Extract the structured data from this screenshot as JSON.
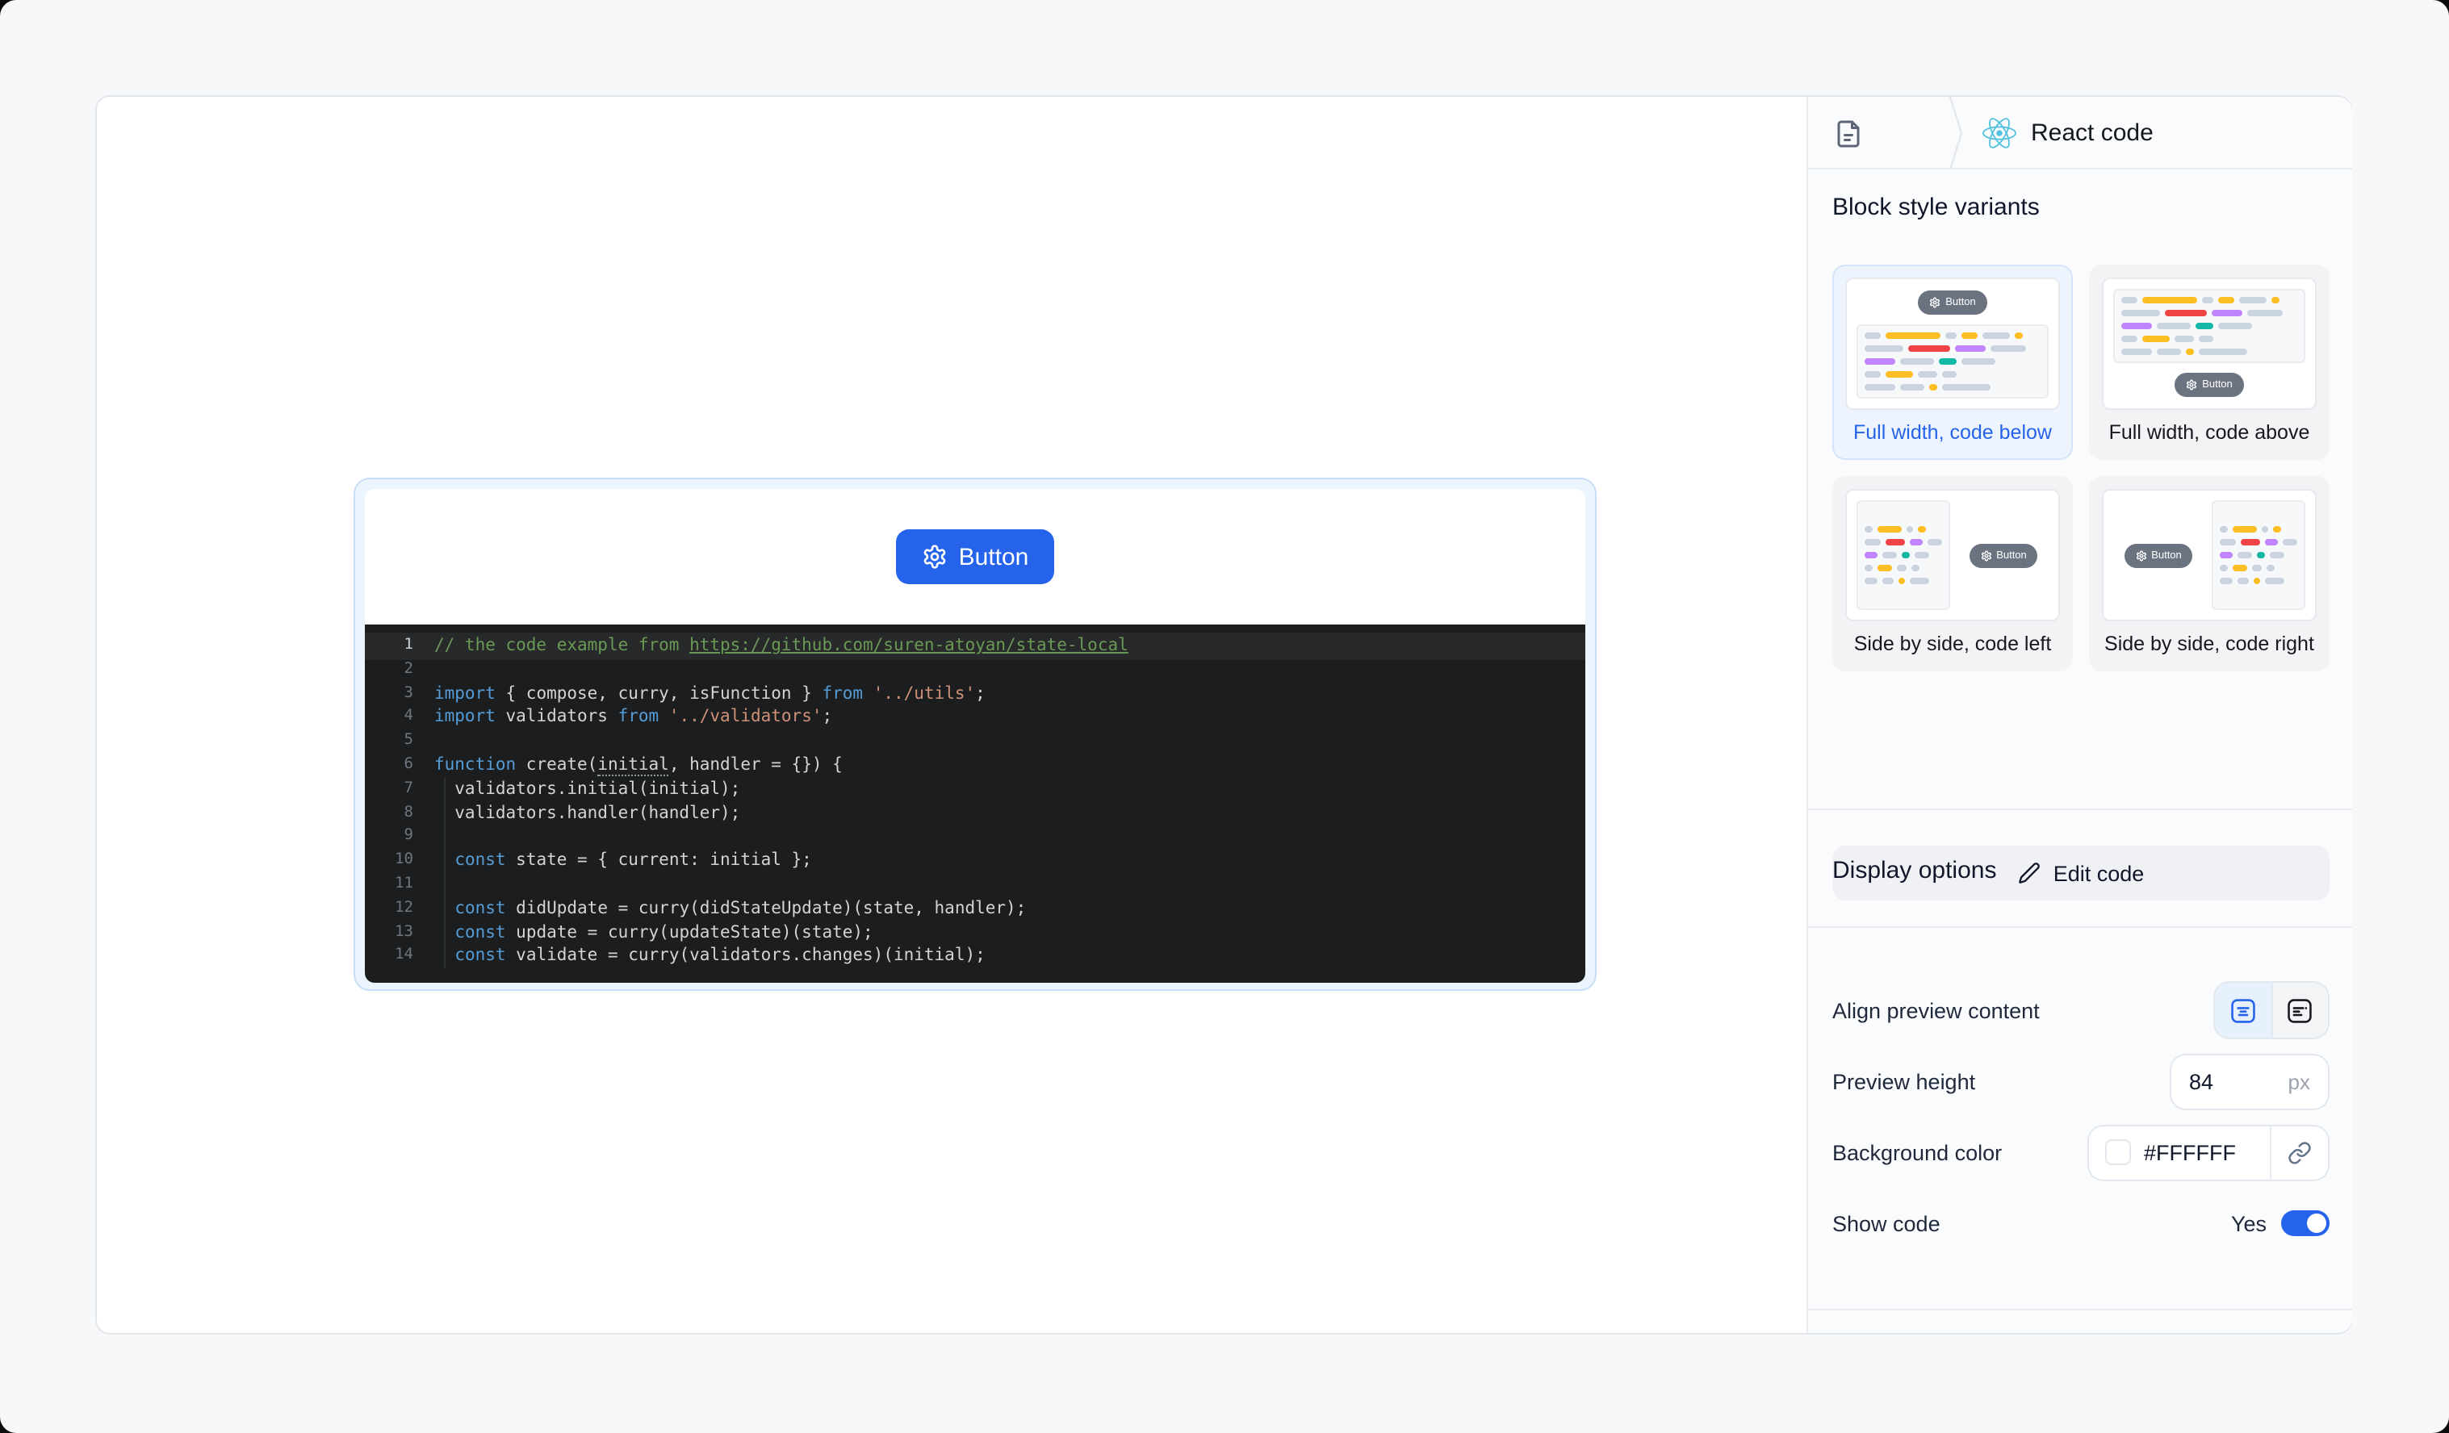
{
  "colors": {
    "accent": "#2563EB",
    "panel_bg": "#FAFBFC",
    "code_bg": "#1B1D1E",
    "comment_green": "#6A9955",
    "keyword_blue": "#569CD6",
    "string_orange": "#CE9178",
    "code_text": "#D4D4D4"
  },
  "icons": {
    "file-icon": "file-text document",
    "breadcrumb-separator": "chevron",
    "react-icon": "react-logo",
    "gear-icon": "settings-gear",
    "pencil-icon": "pencil",
    "align-center-icon": "box with centered lines",
    "align-left-icon": "box with left-aligned lines",
    "link-icon": "chain-link",
    "show-code-toggle": "switch-on"
  },
  "canvas": {
    "block": {
      "preview_button_label": "Button",
      "code": {
        "lines": [
          {
            "n": 1,
            "active": true,
            "segments": [
              {
                "c": "cm",
                "t": "// the code example from "
              },
              {
                "c": "cm lk",
                "t": "https://github.com/suren-atoyan/state-local"
              }
            ]
          },
          {
            "n": 2,
            "segments": []
          },
          {
            "n": 3,
            "segments": [
              {
                "c": "kw",
                "t": "import"
              },
              {
                "c": "pl",
                "t": " { compose, curry, isFunction } "
              },
              {
                "c": "kw",
                "t": "from"
              },
              {
                "c": "pl",
                "t": " "
              },
              {
                "c": "st",
                "t": "'../utils'"
              },
              {
                "c": "pl",
                "t": ";"
              }
            ]
          },
          {
            "n": 4,
            "segments": [
              {
                "c": "kw",
                "t": "import"
              },
              {
                "c": "pl",
                "t": " validators "
              },
              {
                "c": "kw",
                "t": "from"
              },
              {
                "c": "pl",
                "t": " "
              },
              {
                "c": "st",
                "t": "'../validators'"
              },
              {
                "c": "pl",
                "t": ";"
              }
            ]
          },
          {
            "n": 5,
            "segments": []
          },
          {
            "n": 6,
            "segments": [
              {
                "c": "kw",
                "t": "function"
              },
              {
                "c": "pl",
                "t": " create("
              },
              {
                "c": "pl dots",
                "t": "initial"
              },
              {
                "c": "pl",
                "t": ", handler = {}) {"
              }
            ]
          },
          {
            "n": 7,
            "segments": [
              {
                "c": "pl",
                "t": "  validators.initial(initial);"
              }
            ]
          },
          {
            "n": 8,
            "segments": [
              {
                "c": "pl",
                "t": "  validators.handler(handler);"
              }
            ]
          },
          {
            "n": 9,
            "segments": []
          },
          {
            "n": 10,
            "segments": [
              {
                "c": "pl",
                "t": "  "
              },
              {
                "c": "kw",
                "t": "const"
              },
              {
                "c": "pl",
                "t": " state = { current: initial };"
              }
            ]
          },
          {
            "n": 11,
            "segments": []
          },
          {
            "n": 12,
            "segments": [
              {
                "c": "pl",
                "t": "  "
              },
              {
                "c": "kw",
                "t": "const"
              },
              {
                "c": "pl",
                "t": " didUpdate = curry(didStateUpdate)(state, handler);"
              }
            ]
          },
          {
            "n": 13,
            "segments": [
              {
                "c": "pl",
                "t": "  "
              },
              {
                "c": "kw",
                "t": "const"
              },
              {
                "c": "pl",
                "t": " update = curry(updateState)(state);"
              }
            ]
          },
          {
            "n": 14,
            "segments": [
              {
                "c": "pl",
                "t": "  "
              },
              {
                "c": "kw",
                "t": "const"
              },
              {
                "c": "pl",
                "t": " validate = curry(validators.changes)(initial);"
              }
            ]
          }
        ]
      }
    }
  },
  "panel": {
    "header": {
      "title": "React code"
    },
    "variants": {
      "heading": "Block style variants",
      "items": [
        {
          "label": "Full width, code below",
          "layout": "below",
          "selected": true
        },
        {
          "label": "Full width, code above",
          "layout": "above",
          "selected": false
        },
        {
          "label": "Side by side, code left",
          "layout": "left",
          "selected": false
        },
        {
          "label": "Side by side, code right",
          "layout": "right",
          "selected": false
        }
      ]
    },
    "edit_code_label": "Edit code",
    "display_options": {
      "heading": "Display options",
      "align_label": "Align preview content",
      "preview_height_label": "Preview height",
      "preview_height_value": "84",
      "preview_height_unit": "px",
      "background_color_label": "Background color",
      "background_color_value": "#FFFFFF",
      "show_code_label": "Show code",
      "show_code_state": "Yes"
    }
  },
  "thumb": {
    "button_label": "Button",
    "palette": {
      "g": "#CBD5E1",
      "a": "#FBBF24",
      "r": "#EF4444",
      "v": "#C084FC",
      "t": "#14B8A6"
    },
    "rows_full": [
      [
        [
          "g",
          10
        ],
        [
          "a",
          34
        ],
        [
          "g",
          7
        ],
        [
          "a",
          10
        ],
        [
          "g",
          17
        ],
        [
          "a",
          5
        ]
      ],
      [
        [
          "g",
          24
        ],
        [
          "r",
          26
        ],
        [
          "v",
          19
        ],
        [
          "g",
          22
        ]
      ],
      [
        [
          "v",
          19
        ],
        [
          "g",
          21
        ],
        [
          "t",
          11
        ],
        [
          "g",
          21
        ]
      ],
      [
        [
          "g",
          10
        ],
        [
          "a",
          17
        ],
        [
          "g",
          12
        ],
        [
          "g",
          9
        ]
      ],
      [
        [
          "g",
          19
        ],
        [
          "g",
          15
        ],
        [
          "a",
          5
        ],
        [
          "g",
          30
        ]
      ]
    ],
    "rows_side": [
      [
        [
          "g",
          5
        ],
        [
          "a",
          15
        ],
        [
          "g",
          4
        ],
        [
          "a",
          5
        ]
      ],
      [
        [
          "g",
          10
        ],
        [
          "r",
          12
        ],
        [
          "v",
          8
        ],
        [
          "g",
          9
        ]
      ],
      [
        [
          "v",
          8
        ],
        [
          "g",
          9
        ],
        [
          "t",
          5
        ],
        [
          "g",
          9
        ]
      ],
      [
        [
          "g",
          5
        ],
        [
          "a",
          9
        ],
        [
          "g",
          6
        ],
        [
          "g",
          5
        ]
      ],
      [
        [
          "g",
          8
        ],
        [
          "g",
          7
        ],
        [
          "a",
          4
        ],
        [
          "g",
          12
        ]
      ]
    ]
  }
}
